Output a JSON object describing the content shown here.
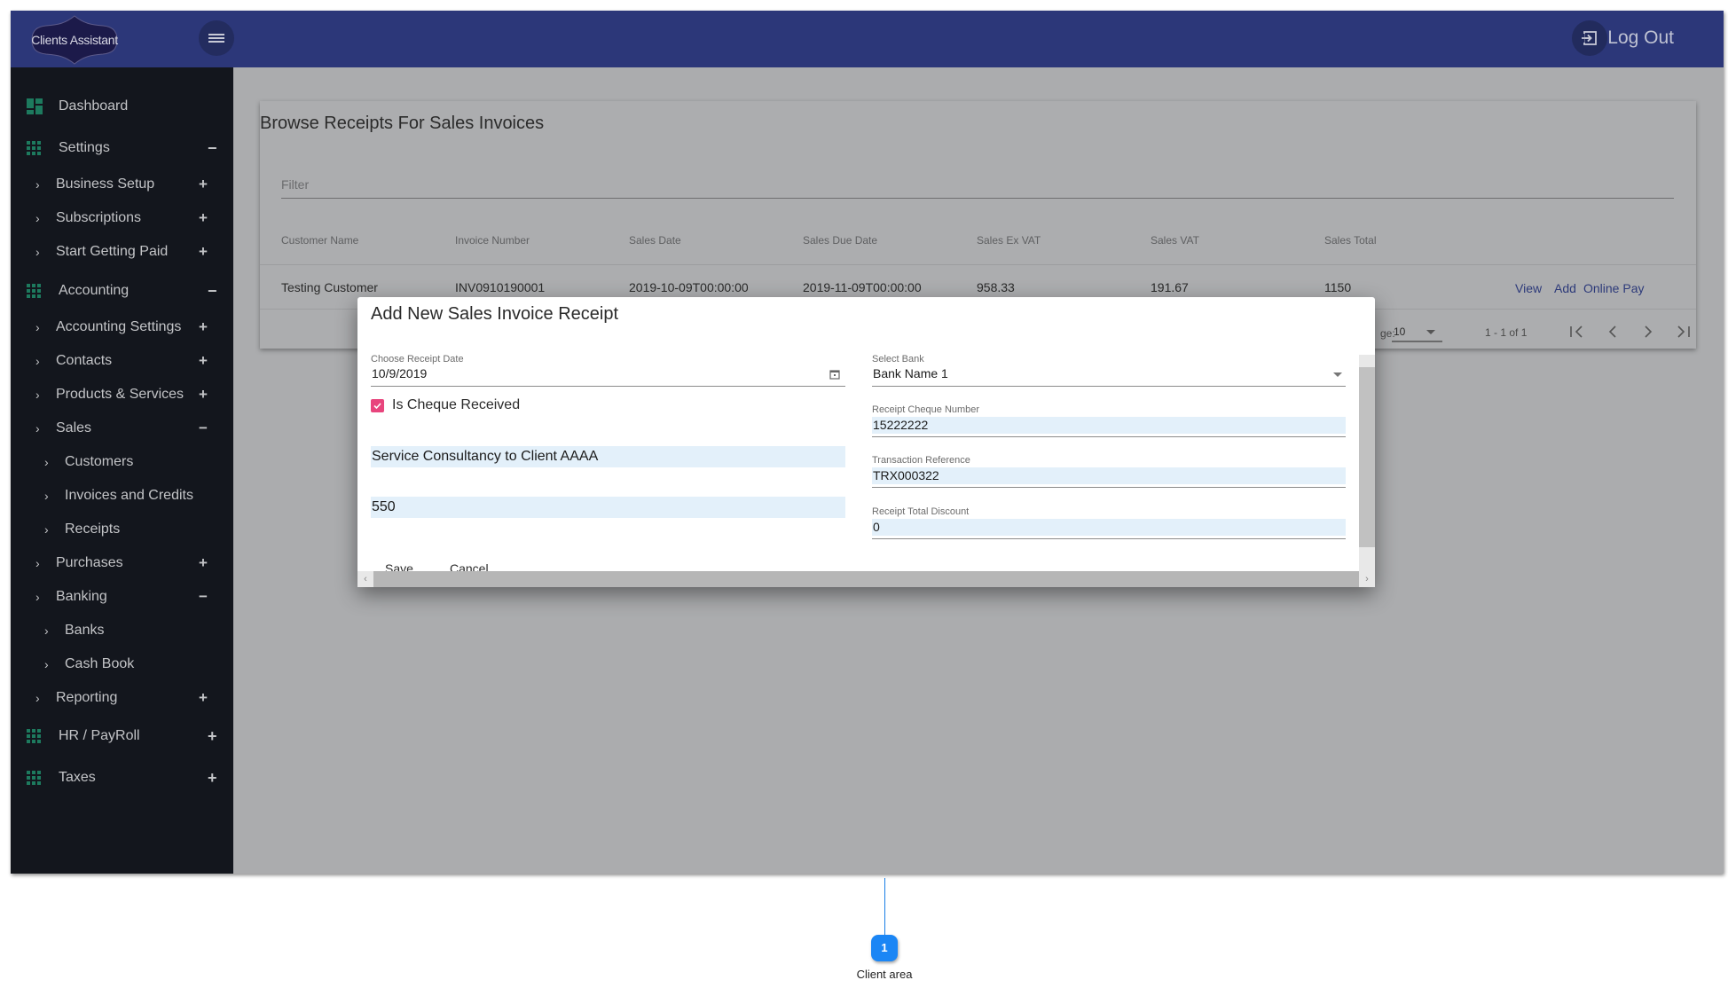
{
  "header": {
    "logo_text": "Clients Assistant",
    "logout_label": "Log Out",
    "colors": {
      "header_bg": "#2c3779",
      "sidebar_bg": "#13161d",
      "accent_green": "#1d7a5e",
      "checkbox": "#e8457d",
      "link": "#2d3a7a"
    }
  },
  "sidebar": {
    "items": [
      {
        "label": "Dashboard",
        "level": 0,
        "icon": "dashboard-icon"
      },
      {
        "label": "Settings",
        "level": 0,
        "icon": "apps-icon",
        "toggle": "−"
      },
      {
        "label": "Business Setup",
        "level": 1,
        "toggle": "+"
      },
      {
        "label": "Subscriptions",
        "level": 1,
        "toggle": "+"
      },
      {
        "label": "Start Getting Paid",
        "level": 1,
        "toggle": "+"
      },
      {
        "label": "Accounting",
        "level": 0,
        "icon": "apps-icon",
        "toggle": "−"
      },
      {
        "label": "Accounting Settings",
        "level": 1,
        "toggle": "+"
      },
      {
        "label": "Contacts",
        "level": 1,
        "toggle": "+"
      },
      {
        "label": "Products & Services",
        "level": 1,
        "toggle": "+"
      },
      {
        "label": "Sales",
        "level": 1,
        "toggle": "−"
      },
      {
        "label": "Customers",
        "level": 2
      },
      {
        "label": "Invoices and Credits",
        "level": 2
      },
      {
        "label": "Receipts",
        "level": 2
      },
      {
        "label": "Purchases",
        "level": 1,
        "toggle": "+"
      },
      {
        "label": "Banking",
        "level": 1,
        "toggle": "−"
      },
      {
        "label": "Banks",
        "level": 2
      },
      {
        "label": "Cash Book",
        "level": 2
      },
      {
        "label": "Reporting",
        "level": 1,
        "toggle": "+"
      },
      {
        "label": "HR / PayRoll",
        "level": 0,
        "icon": "apps-icon",
        "toggle": "+"
      },
      {
        "label": "Taxes",
        "level": 0,
        "icon": "apps-icon",
        "toggle": "+"
      }
    ]
  },
  "main": {
    "title": "Browse Receipts For Sales Invoices",
    "filter_placeholder": "Filter",
    "table": {
      "columns": [
        "Customer Name",
        "Invoice Number",
        "Sales Date",
        "Sales Due Date",
        "Sales Ex VAT",
        "Sales VAT",
        "Sales Total"
      ],
      "rows": [
        [
          "Testing Customer",
          "INV0910190001",
          "2019-10-09T00:00:00",
          "2019-11-09T00:00:00",
          "958.33",
          "191.67",
          "1150"
        ]
      ],
      "row_actions": [
        "View",
        "Add",
        "Online Pay"
      ]
    },
    "paginator": {
      "items_per_page_label_visible": "ge:",
      "page_size": "10",
      "range_label": "1 - 1 of 1"
    }
  },
  "modal": {
    "title": "Add New Sales Invoice Receipt",
    "receipt_date": {
      "label": "Choose Receipt Date",
      "value": "10/9/2019"
    },
    "cheque_received": {
      "label": "Is Cheque Received",
      "checked": true
    },
    "description_value": "Service Consultancy to Client AAAA",
    "amount_value": "550",
    "bank": {
      "label": "Select Bank",
      "value": "Bank Name 1"
    },
    "cheque_number": {
      "label": "Receipt Cheque Number",
      "value": "15222222"
    },
    "transaction_reference": {
      "label": "Transaction Reference",
      "value": "TRX000322"
    },
    "total_discount": {
      "label": "Receipt Total Discount",
      "value": "0"
    },
    "buttons": {
      "save": "Save",
      "cancel": "Cancel"
    }
  },
  "callout": {
    "number": "1",
    "label": "Client area"
  }
}
